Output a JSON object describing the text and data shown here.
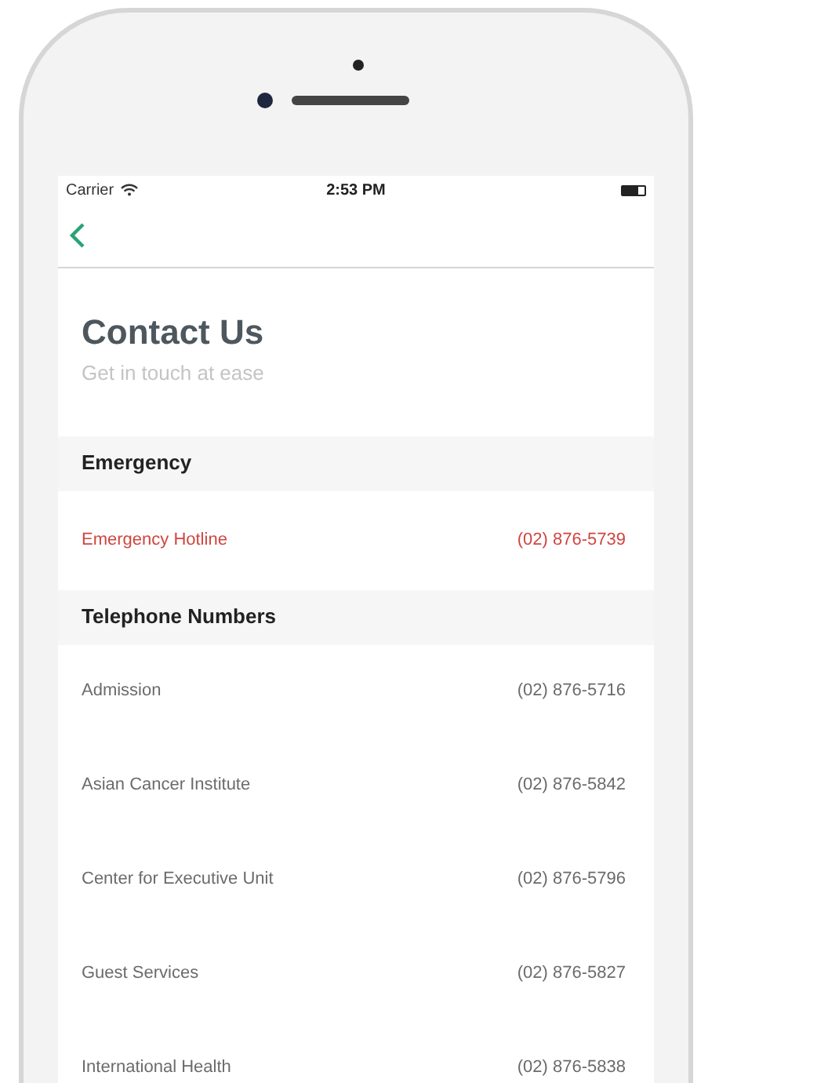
{
  "status_bar": {
    "carrier": "Carrier",
    "time": "2:53 PM"
  },
  "header": {
    "title": "Contact Us",
    "subtitle": "Get in touch at ease"
  },
  "sections": [
    {
      "title": "Emergency",
      "items": [
        {
          "kind": "emergency",
          "name": "Emergency Hotline",
          "phone": "(02) 876-5739"
        }
      ]
    },
    {
      "title": "Telephone Numbers",
      "items": [
        {
          "kind": "normal",
          "name": "Admission",
          "phone": "(02) 876-5716"
        },
        {
          "kind": "normal",
          "name": "Asian Cancer Institute",
          "phone": "(02) 876-5842"
        },
        {
          "kind": "normal",
          "name": "Center for Executive Unit",
          "phone": "(02) 876-5796"
        },
        {
          "kind": "normal",
          "name": "Guest Services",
          "phone": "(02) 876-5827"
        },
        {
          "kind": "normal",
          "name": "International Health",
          "phone": "(02) 876-5838"
        }
      ]
    }
  ]
}
